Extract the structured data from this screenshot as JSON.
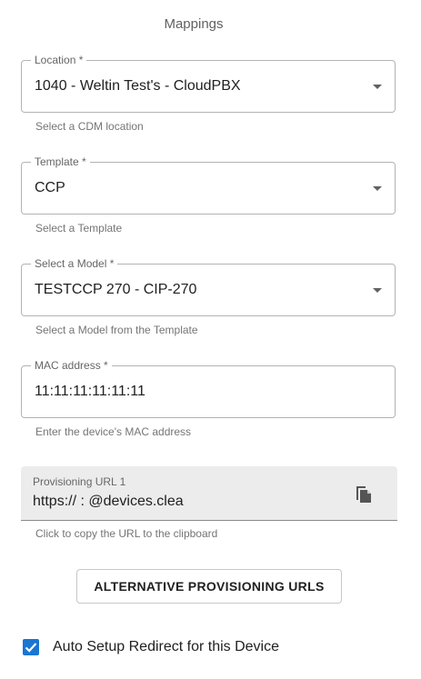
{
  "page": {
    "title": "Mappings"
  },
  "location": {
    "label": "Location *",
    "value": "1040 - Weltin Test's - CloudPBX",
    "helper": "Select a CDM location"
  },
  "template": {
    "label": "Template *",
    "value": "CCP",
    "helper": "Select a Template"
  },
  "model": {
    "label": "Select a Model *",
    "value": "TESTCCP 270 - CIP-270",
    "helper": "Select a Model from the Template"
  },
  "mac": {
    "label": "MAC address *",
    "value": "11:11:11:11:11:11",
    "helper": "Enter the device's MAC address"
  },
  "provisioning": {
    "label": "Provisioning URL 1",
    "value": "https://              :           @devices.clea",
    "helper": "Click to copy the URL to the clipboard",
    "icon": "copy-icon"
  },
  "alternative_button": {
    "label": "ALTERNATIVE PROVISIONING URLS"
  },
  "auto_setup": {
    "label": "Auto Setup Redirect for this Device",
    "checked": true,
    "color": "#1976d2"
  }
}
